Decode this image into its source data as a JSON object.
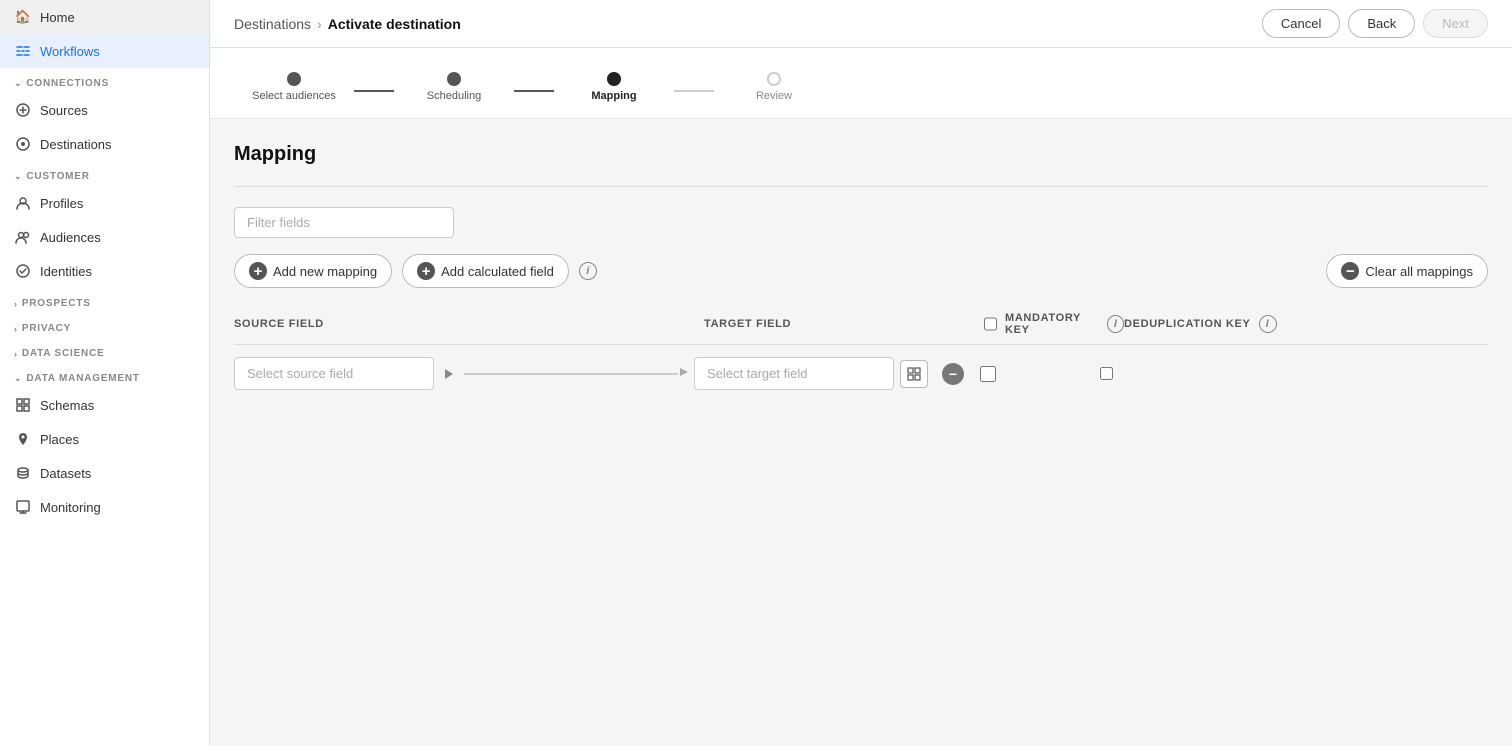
{
  "sidebar": {
    "items": [
      {
        "id": "home",
        "label": "Home",
        "icon": "🏠",
        "active": false
      },
      {
        "id": "workflows",
        "label": "Workflows",
        "icon": "⇄",
        "active": true
      }
    ],
    "sections": [
      {
        "id": "connections",
        "label": "CONNECTIONS",
        "collapsed": false,
        "children": [
          {
            "id": "sources",
            "label": "Sources",
            "icon": "←"
          },
          {
            "id": "destinations",
            "label": "Destinations",
            "icon": "⊙"
          }
        ]
      },
      {
        "id": "customer",
        "label": "CUSTOMER",
        "collapsed": false,
        "children": [
          {
            "id": "profiles",
            "label": "Profiles",
            "icon": "👤"
          },
          {
            "id": "audiences",
            "label": "Audiences",
            "icon": "⊕"
          },
          {
            "id": "identities",
            "label": "Identities",
            "icon": "⊗"
          }
        ]
      },
      {
        "id": "prospects",
        "label": "PROSPECTS",
        "collapsed": true,
        "children": []
      },
      {
        "id": "privacy",
        "label": "PRIVACY",
        "collapsed": true,
        "children": []
      },
      {
        "id": "data_science",
        "label": "DATA SCIENCE",
        "collapsed": true,
        "children": []
      },
      {
        "id": "data_management",
        "label": "DATA MANAGEMENT",
        "collapsed": false,
        "children": [
          {
            "id": "schemas",
            "label": "Schemas",
            "icon": "⊞"
          },
          {
            "id": "places",
            "label": "Places",
            "icon": "📍"
          },
          {
            "id": "datasets",
            "label": "Datasets",
            "icon": "🗄"
          },
          {
            "id": "monitoring",
            "label": "Monitoring",
            "icon": "⊟"
          }
        ]
      }
    ]
  },
  "topbar": {
    "breadcrumb_parent": "Destinations",
    "breadcrumb_separator": "›",
    "breadcrumb_current": "Activate destination",
    "cancel_label": "Cancel",
    "back_label": "Back",
    "next_label": "Next"
  },
  "steps": [
    {
      "id": "select-audiences",
      "label": "Select audiences",
      "state": "done"
    },
    {
      "id": "scheduling",
      "label": "Scheduling",
      "state": "done"
    },
    {
      "id": "mapping",
      "label": "Mapping",
      "state": "active"
    },
    {
      "id": "review",
      "label": "Review",
      "state": "pending"
    }
  ],
  "mapping": {
    "title": "Mapping",
    "filter_placeholder": "Filter fields",
    "add_mapping_label": "Add new mapping",
    "add_calculated_label": "Add calculated field",
    "clear_all_label": "Clear all mappings",
    "source_field_header": "SOURCE FIELD",
    "target_field_header": "TARGET FIELD",
    "mandatory_key_header": "MANDATORY KEY",
    "deduplication_key_header": "DEDUPLICATION KEY",
    "row": {
      "source_placeholder": "Select source field",
      "target_placeholder": "Select target field"
    }
  }
}
